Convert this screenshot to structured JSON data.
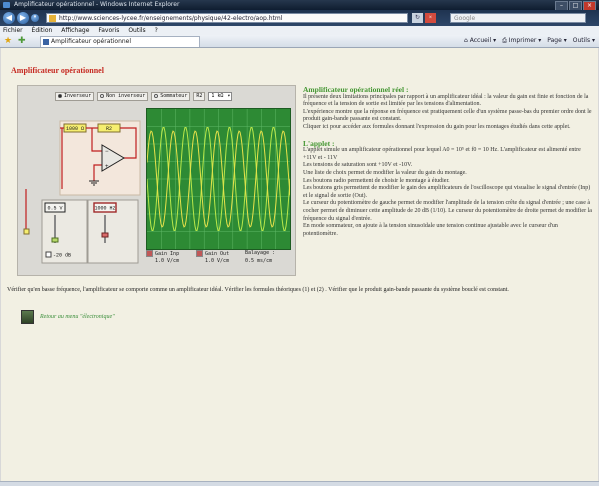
{
  "window": {
    "title": "Amplificateur opérationnel - Windows Internet Explorer"
  },
  "address": {
    "url": "http://www.sciences-lycee.fr/enseignements/physique/42-electro/aop.html",
    "search_placeholder": "Google"
  },
  "menu": [
    "Fichier",
    "Édition",
    "Affichage",
    "Favoris",
    "Outils",
    "?"
  ],
  "tab": {
    "label": "Amplificateur opérationnel"
  },
  "commands": [
    "Accueil",
    "Imprimer",
    "Page",
    "Outils"
  ],
  "page": {
    "title": "Amplificateur opérationnel"
  },
  "applet": {
    "radios": [
      {
        "label": "Inverseur",
        "selected": true
      },
      {
        "label": "Non inverseur",
        "selected": false
      },
      {
        "label": "Sommateur",
        "selected": false
      }
    ],
    "r_select_label": "R2",
    "r_select_value": "1 kΩ",
    "resistor_r1": "1000 Ω",
    "resistor_r2": "R2",
    "input_amp": "0.5 V",
    "input_freq": "1000 Hz",
    "attenuator_label": "-20 dB",
    "readouts": {
      "gain_inp_label": "Gain Inp",
      "gain_inp_value": "1.0 V/cm",
      "gain_out_label": "Gain Out",
      "gain_out_value": "1.0 V/cm",
      "sweep_label": "Balayage :",
      "sweep_value": "0.5 ms/cm"
    },
    "colors": {
      "screen": "#2d8a34",
      "trace_in": "#e8e24a",
      "trace_out": "#b8e84a",
      "grid": "#5fb866"
    }
  },
  "text": {
    "h1": "Amplificateur opérationnel réel :",
    "p1": "Il présente deux limitations principales par rapport à un amplificateur idéal : la valeur du gain est finie et fonction de la fréquence et la tension de sortie est limitée par les tensions d'alimentation.",
    "p2": "L'expérience montre que la réponse en fréquence est pratiquement celle d'un système passe-bas du premier ordre dont le produit gain-bande passante est constant.",
    "p3": "Cliquer ici pour accéder aux formules donnant l'expression du gain pour les montages étudiés dans cette applet.",
    "h2": "L'applet :",
    "a1": "L'applet simule un amplificateur opérationnel pour lequel A0 = 10⁵ et f0 = 10 Hz. L'amplificateur est alimenté entre +11V et - 11V",
    "a2": "Les tensions de saturation sont +10V et -10V.",
    "a3": "Une liste de choix permet de modifier la valeur du gain du montage.",
    "a4": "Les boutons radio permettent de choisir le montage à étudier.",
    "a5": "Les boutons gris permettent de modifier le gain des amplificateurs de l'oscilloscope qui visualise le signal d'entrée (Inp) et le signal de sortie (Out).",
    "a6": "Le curseur du potentiomètre de gauche permet de modifier l'amplitude de la tension crête du signal d'entrée ; une case à cocher permet de diminuer cette amplitude de 20 dB (1/10). Le curseur du potentiomètre de droite permet de modifier la fréquence du signal d'entrée.",
    "a7": "En mode sommateur, on ajoute à la tension sinusoïdale une tension continue ajustable avec le curseur d'un potentiomètre.",
    "bottom": "Vérifier qu'en basse fréquence, l'amplificateur se comporte comme un amplificateur idéal. Vérifier les formules théoriques (1) et (2) . Vérifier que le produit gain-bande passante du système bouclé est constant.",
    "back_link": "Retour au menu \"électronique\""
  }
}
